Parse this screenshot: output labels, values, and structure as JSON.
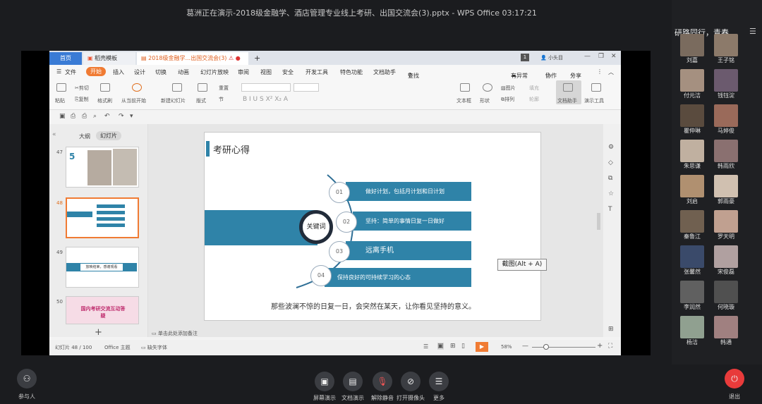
{
  "window": {
    "title": "葛洲正在演示-2018级金融学、酒店管理专业线上考研、出国交流会(3).pptx - WPS Office 03:17:21"
  },
  "roster_header": "研路同行，青春...",
  "wps": {
    "tabs": {
      "home": "首页",
      "template": "稻壳模板",
      "doc": "2018级金融学...出国交流会(3)"
    },
    "page_badge": "1",
    "user": "小头目",
    "menu": [
      "文件",
      "开始",
      "插入",
      "设计",
      "切换",
      "动画",
      "幻灯片放映",
      "审阅",
      "视图",
      "安全",
      "开发工具",
      "特色功能",
      "文档助手",
      "查找"
    ],
    "menu_right": {
      "unsync": "有异常",
      "collab": "协作",
      "share": "分享"
    },
    "toolbar": {
      "paste": "粘贴",
      "cut": "剪切",
      "copy": "复制",
      "format": "格式刷",
      "from_current": "从当前开始",
      "new_slide": "新建幻灯片",
      "layout": "版式",
      "section": "节",
      "reset": "重置",
      "textbox": "文本框",
      "shape": "形状",
      "image": "图片",
      "arrange": "排列",
      "fill": "填充",
      "outline": "轮廓",
      "doc_helper": "文档助手",
      "present_tool": "演示工具"
    },
    "pane_tabs": {
      "outline": "大纲",
      "slides": "幻灯片"
    },
    "thumbs": [
      {
        "num": "47"
      },
      {
        "num": "48"
      },
      {
        "num": "49",
        "text": "放映结束，感谢观看"
      },
      {
        "num": "50",
        "text": "国内考研交流互动答疑"
      }
    ],
    "add_notes": "单击此处添加备注",
    "status": {
      "slide": "幻灯片 48 / 100",
      "theme": "Office 主题",
      "font": "缺失字体",
      "zoom": "58%"
    }
  },
  "slide": {
    "title": "考研心得",
    "center": "关键词",
    "items": [
      {
        "num": "01",
        "text": "做好计划，包括月计划和日计划"
      },
      {
        "num": "02",
        "text": "坚持：简单的事情日复一日做好"
      },
      {
        "num": "03",
        "text": "远离手机"
      },
      {
        "num": "04",
        "text": "保持良好的可持续学习的心态"
      }
    ],
    "quote": "那些波澜不惊的日复一日，会突然在某天，让你看见坚持的意义。"
  },
  "tooltip": "截图(Alt + A)",
  "participants": [
    "刘嘉",
    "王子铭",
    "付元洁",
    "钱钰淀",
    "瞿伸琳",
    "马婷俊",
    "朱思谦",
    "韩雨欣",
    "刘启",
    "郭雨豪",
    "秦鲁江",
    "罗天明",
    "张馨然",
    "宋俊磊",
    "李润然",
    "何晓璇",
    "杨洁",
    "韩通"
  ],
  "bottom": {
    "participants": "参与人",
    "share_screen": "屏幕演示",
    "share_doc": "文档演示",
    "unmute": "解除静音",
    "camera": "打开摄像头",
    "more": "更多",
    "leave": "退出"
  },
  "colors": {
    "accent": "#2f83a8",
    "wps_orange": "#f07b33",
    "leave": "#e83b3b"
  }
}
